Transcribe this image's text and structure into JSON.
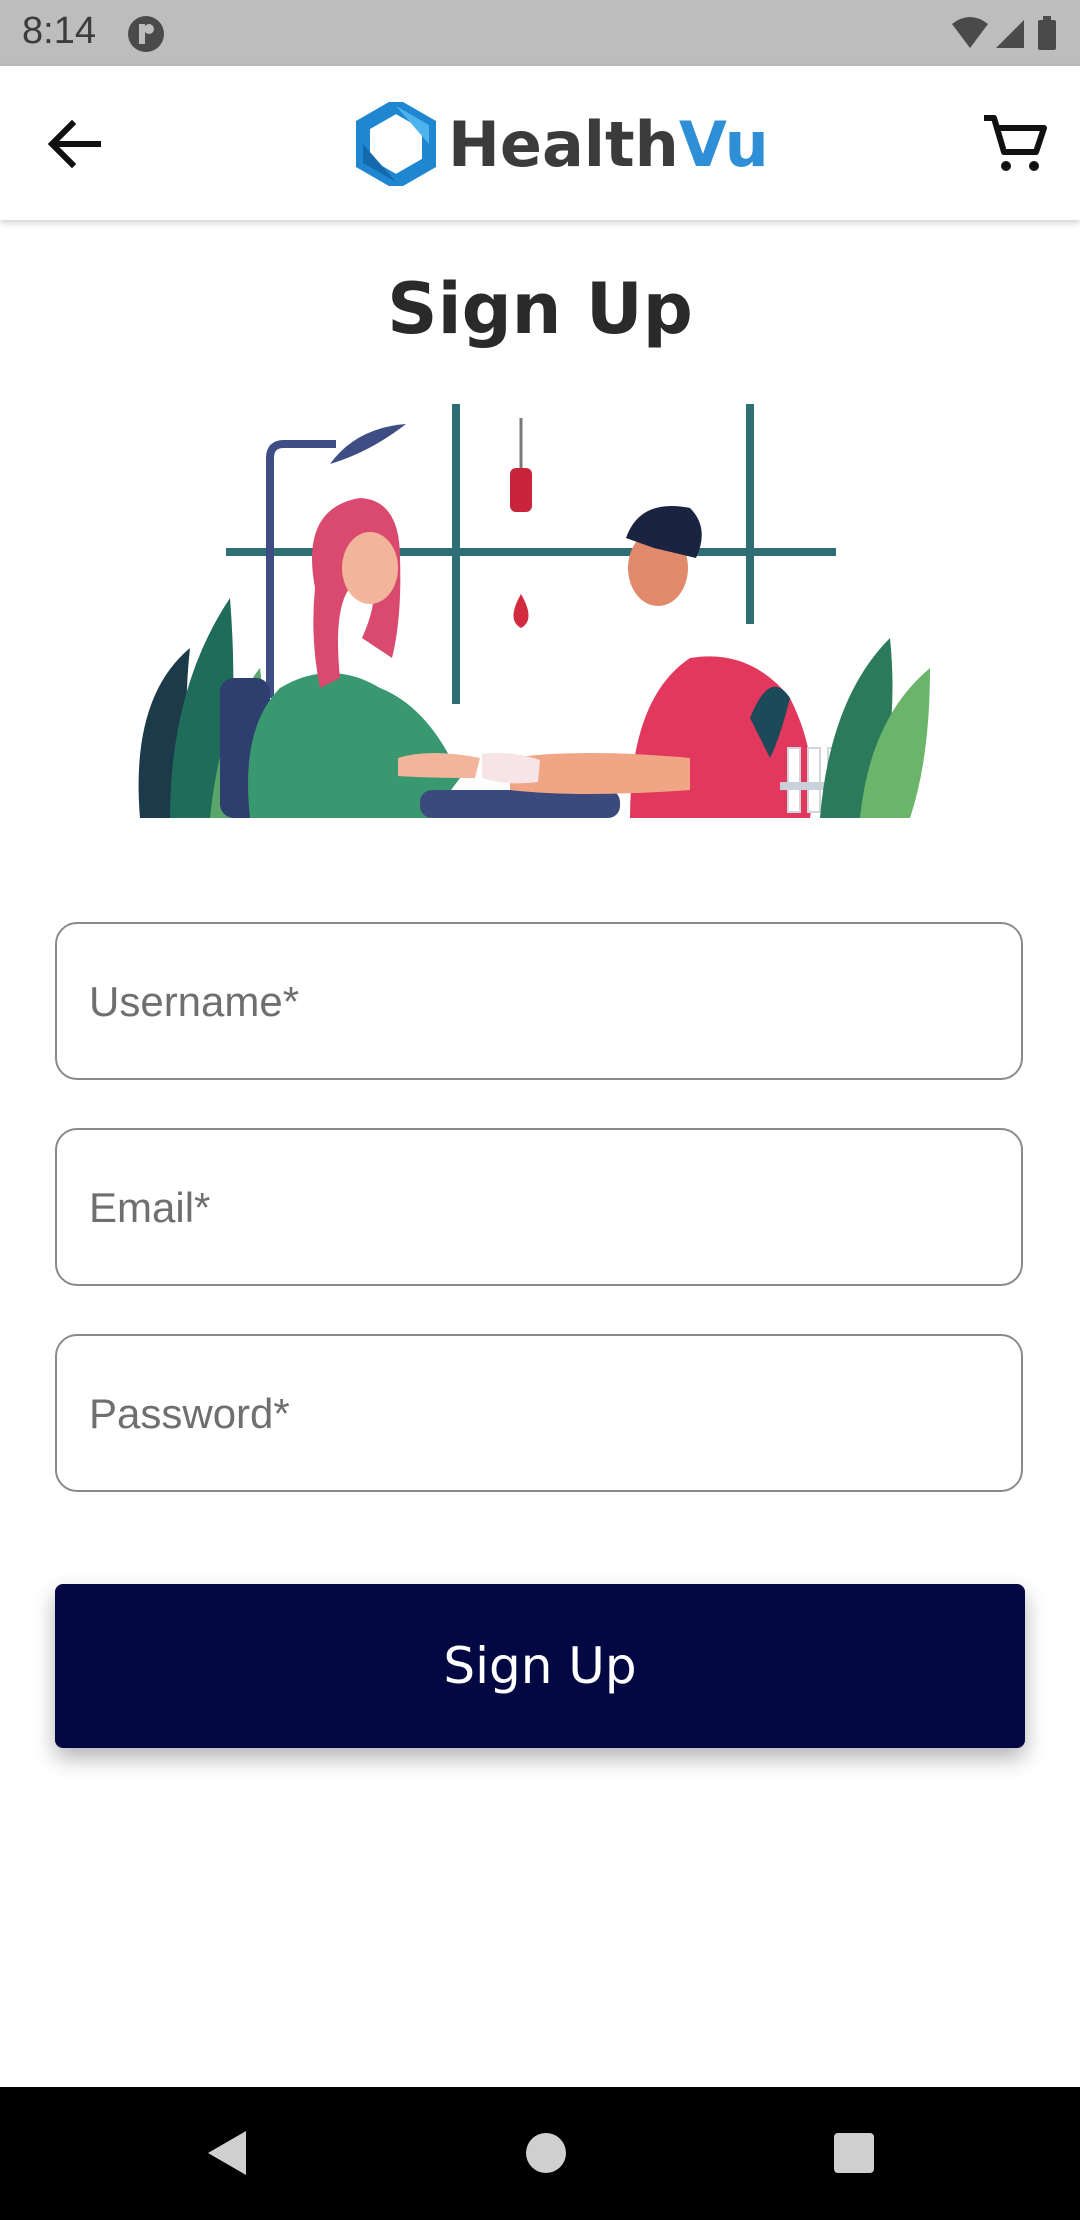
{
  "status_bar": {
    "time": "8:14",
    "icons": [
      "app-notification-icon",
      "wifi-icon",
      "cell-signal-icon",
      "battery-icon"
    ]
  },
  "app_bar": {
    "brand_name_part1": "Health",
    "brand_name_part2": "Vu",
    "icons": [
      "back-arrow-icon",
      "hexagon-logo-icon",
      "shopping-cart-icon"
    ]
  },
  "page": {
    "title": "Sign Up"
  },
  "form": {
    "username_placeholder": "Username*",
    "email_placeholder": "Email*",
    "password_placeholder": "Password*",
    "submit_label": "Sign Up"
  },
  "nav_bar": {
    "icons": [
      "nav-back-icon",
      "nav-home-icon",
      "nav-recents-icon"
    ]
  },
  "colors": {
    "primary_button": "#030842",
    "brand_accent": "#2e8fd6",
    "status_bar": "#bdbdbd"
  }
}
